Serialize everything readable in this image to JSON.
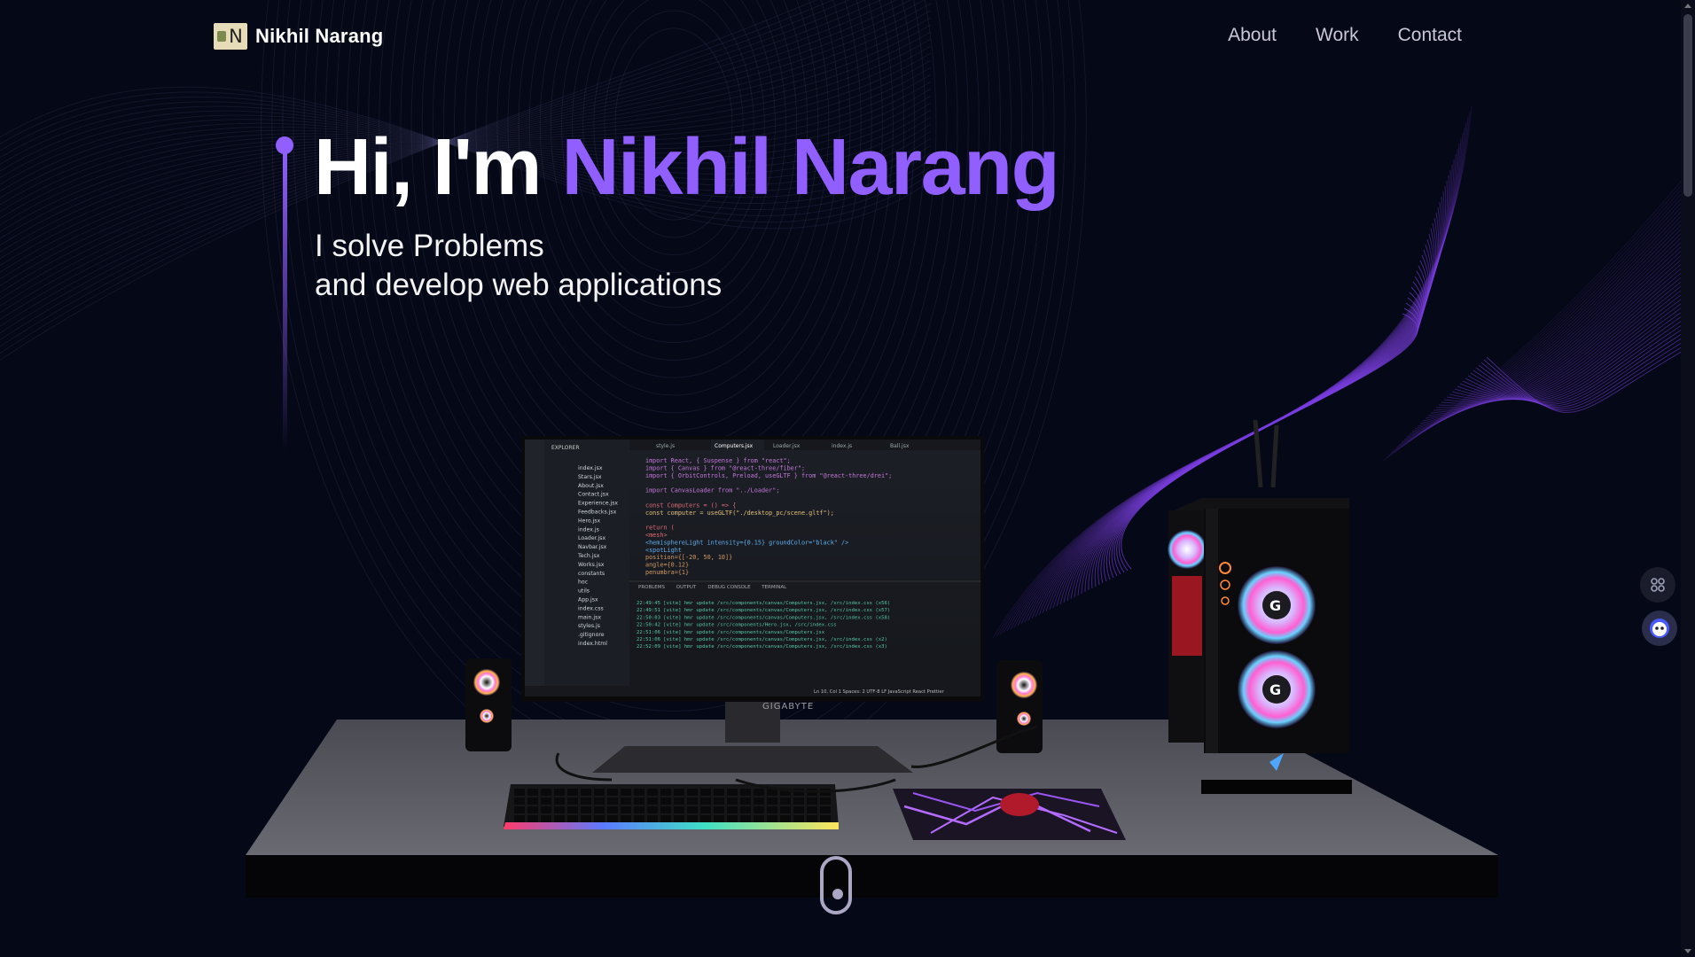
{
  "nav": {
    "logo_initial": "N",
    "brand": "Nikhil Narang",
    "links": [
      "About",
      "Work",
      "Contact"
    ]
  },
  "hero": {
    "greeting": "Hi, I'm ",
    "name": "Nikhil Narang",
    "tagline_line1": "I solve Problems",
    "tagline_line2": "and develop web applications"
  },
  "monitor": {
    "brand": "GIGABYTE",
    "tabs": [
      "style.js",
      "Computers.jsx",
      "Loader.jsx",
      "index.js",
      "Ball.jsx"
    ],
    "explorer_title": "EXPLORER",
    "files": [
      "index.jsx",
      "Stars.jsx",
      "About.jsx",
      "Contact.jsx",
      "Experience.jsx",
      "Feedbacks.jsx",
      "Hero.jsx",
      "index.js",
      "Loader.jsx",
      "Navbar.jsx",
      "Tech.jsx",
      "Works.jsx",
      "constants",
      "hoc",
      "utils",
      "App.jsx",
      "index.css",
      "main.jsx",
      "styles.js",
      ".gitignore",
      "index.html"
    ],
    "code": [
      "import React, { Suspense } from \"react\";",
      "import { Canvas } from \"@react-three/fiber\";",
      "import { OrbitControls, Preload, useGLTF } from \"@react-three/drei\";",
      "",
      "import CanvasLoader from \"../Loader\";",
      "",
      "const Computers = () => {",
      "  const computer = useGLTF(\"./desktop_pc/scene.gltf\");",
      "",
      "  return (",
      "    <mesh>",
      "      <hemisphereLight intensity={0.15} groundColor=\"black\" />",
      "      <spotLight",
      "        position={[-20, 50, 10]}",
      "        angle={0.12}",
      "        penumbra={1}"
    ],
    "panel_tabs": [
      "PROBLEMS",
      "OUTPUT",
      "DEBUG CONSOLE",
      "TERMINAL"
    ],
    "terminal": [
      "22:49:45 [vite] hmr update /src/components/canvas/Computers.jsx, /src/index.css (x56)",
      "22:49:51 [vite] hmr update /src/components/canvas/Computers.jsx, /src/index.css (x57)",
      "22:50:03 [vite] hmr update /src/components/canvas/Computers.jsx, /src/index.css (x58)",
      "22:50:42 [vite] hmr update /src/components/Hero.jsx, /src/index.css",
      "22:51:06 [vite] hmr update /src/components/canvas/Computers.jsx",
      "22:51:06 [vite] hmr update /src/components/canvas/Computers.jsx, /src/index.css (x2)",
      "22:52:09 [vite] hmr update /src/components/canvas/Computers.jsx, /src/index.css (x3)"
    ],
    "status": "Ln 10, Col 1   Spaces: 2   UTF-8   LF   JavaScript React   Prettier"
  },
  "colors": {
    "background": "#050816",
    "accent": "#915eff",
    "nav_link": "#c9c6d9"
  },
  "icons": {
    "scroll": "mouse-scroll-icon",
    "side_top": "grid-icon",
    "side_bottom": "bot-icon"
  }
}
